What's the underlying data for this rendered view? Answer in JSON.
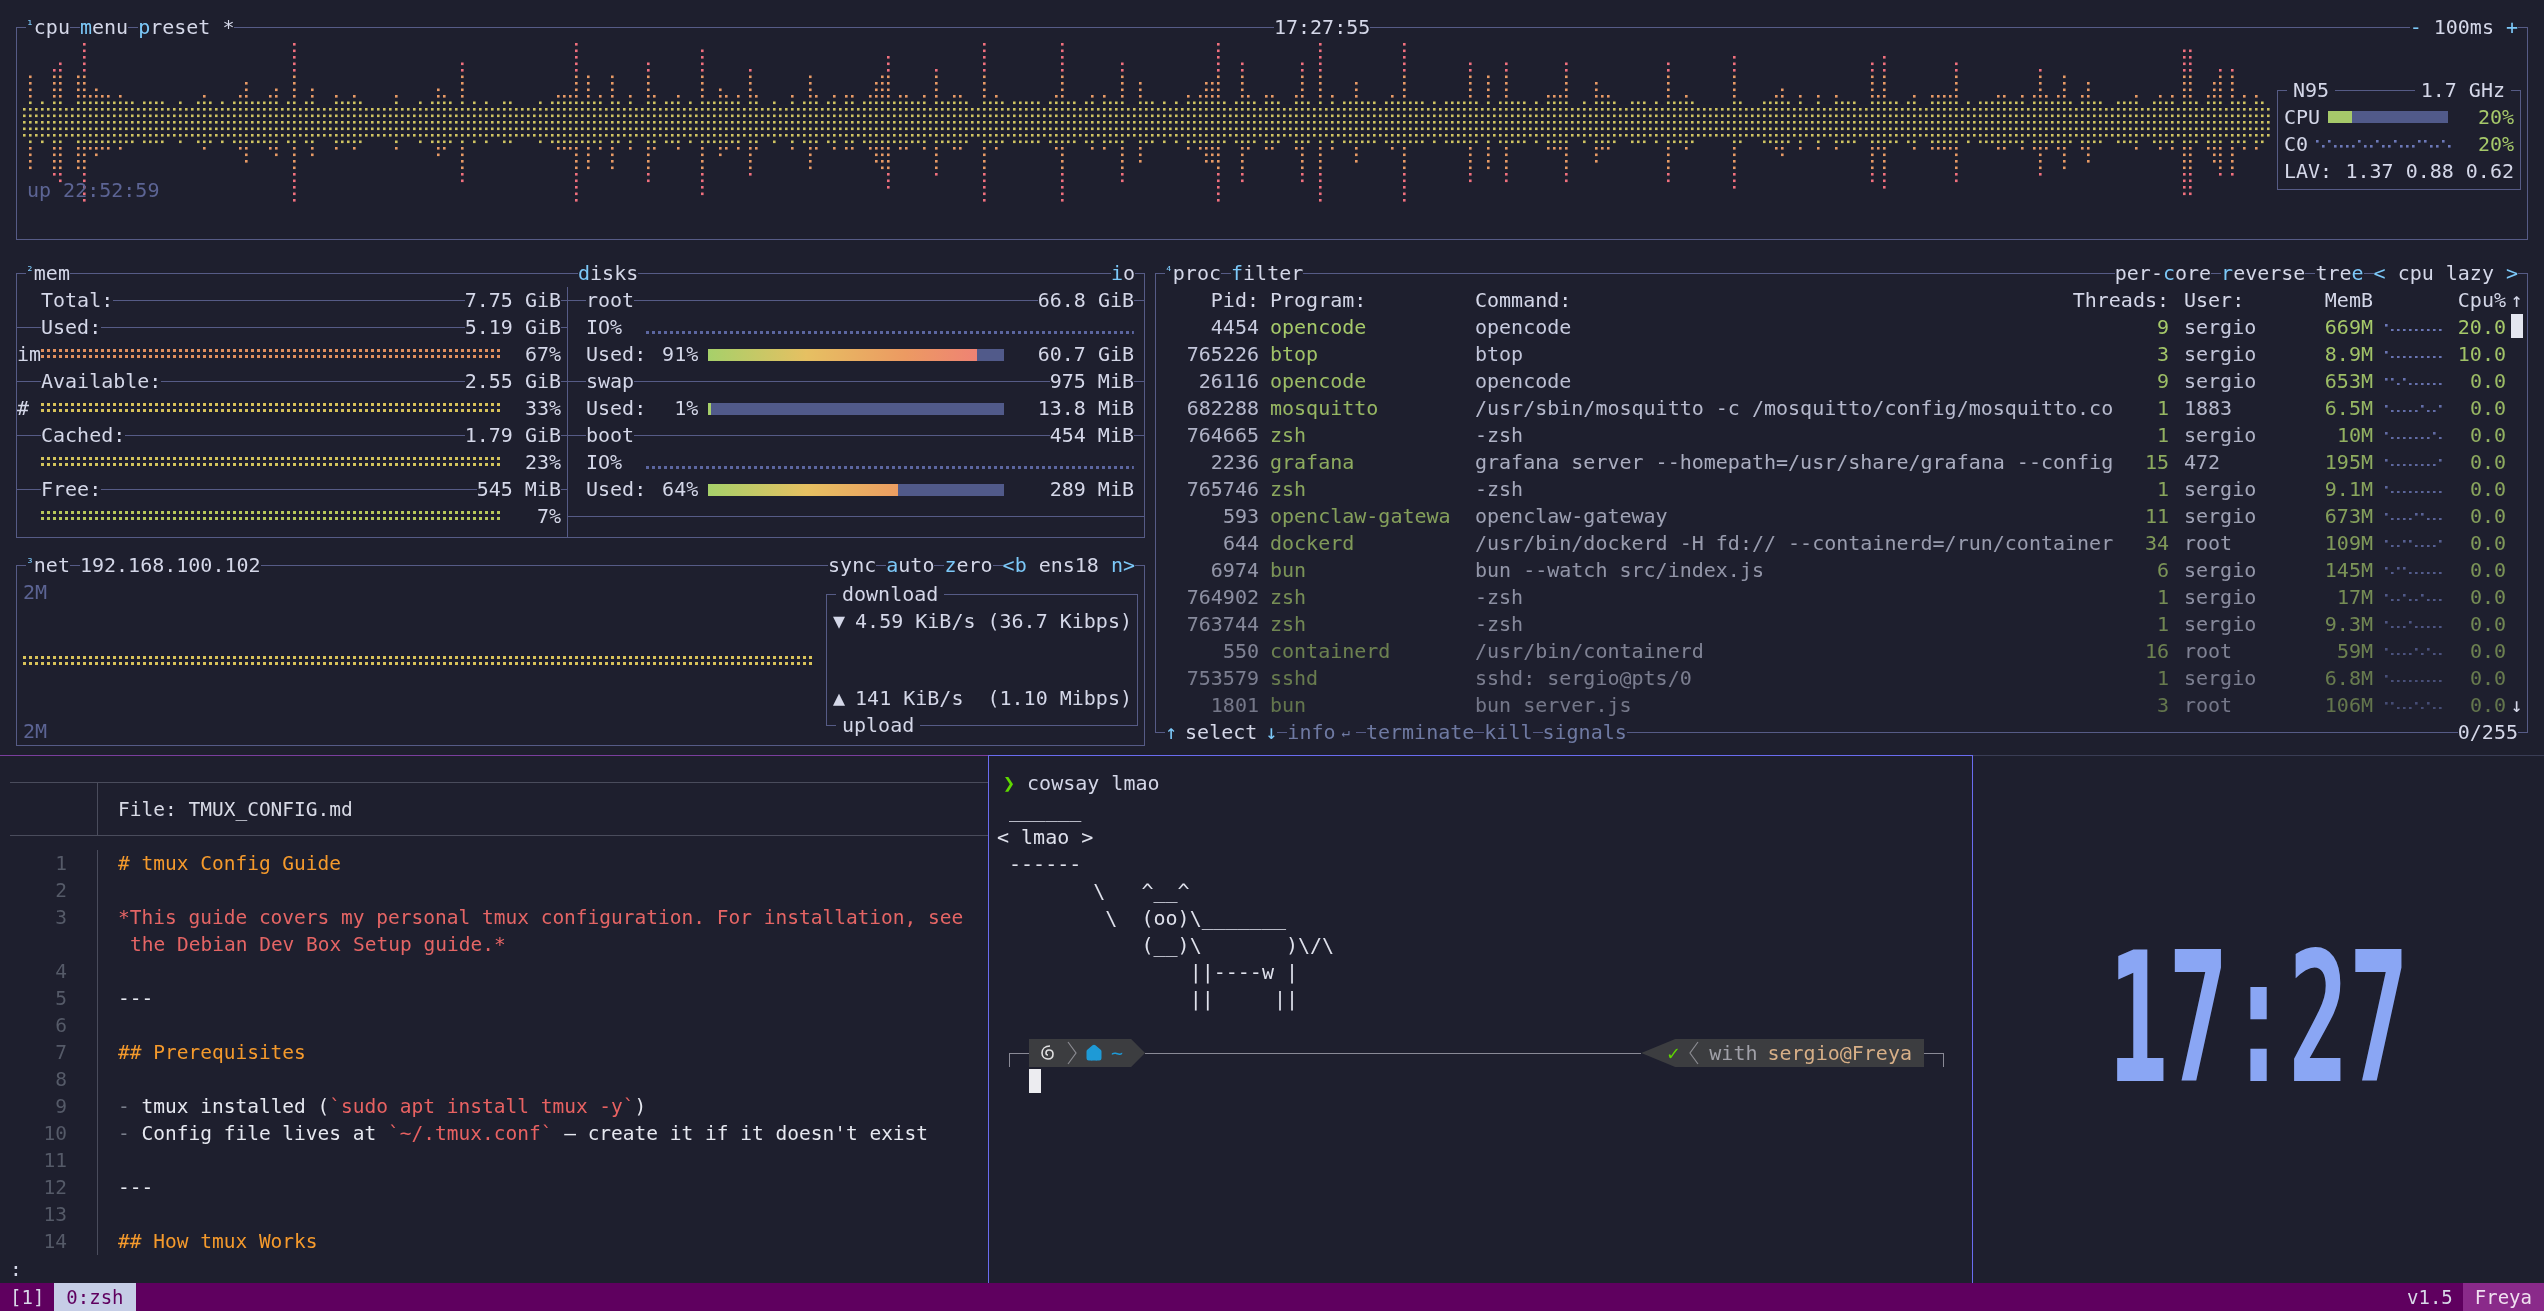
{
  "cpu": {
    "number": "¹",
    "title": "cpu",
    "menu": {
      "key": "m",
      "rest": "enu"
    },
    "preset": {
      "key": "p",
      "rest": "reset *"
    },
    "clock": "17:27:55",
    "interval_down": "-",
    "interval": "100ms",
    "interval_up": "+",
    "uptime": "up 22:52:59",
    "info": {
      "model": "N95",
      "frequency": "1.7 GHz",
      "cpu_label": "CPU",
      "level": 0.2,
      "cpu_percent": "20%",
      "core_label": "C0",
      "core_percent": "20%",
      "load_label": "LAV:",
      "load": "1.37 0.88 0.62"
    }
  },
  "mem": {
    "number": "²",
    "title": "mem",
    "rows": [
      {
        "label": "Total:",
        "value": "7.75 GiB"
      },
      {
        "label": "Used:",
        "value": "5.19 GiB",
        "graph_prefix": "im",
        "percent": "67%",
        "color": "#e0905e"
      },
      {
        "label": "Available:",
        "value": "2.55 GiB",
        "graph_prefix": "#",
        "percent": "33%",
        "color": "#d8c25a"
      },
      {
        "label": "Cached:",
        "value": "1.79 GiB",
        "percent": "23%",
        "color": "#d2c45c"
      },
      {
        "label": "Free:",
        "value": "545 MiB",
        "percent": "7%",
        "color": "#b8c85a"
      }
    ]
  },
  "disks": {
    "title": {
      "key": "d",
      "rest": "isks"
    },
    "io": {
      "key": "i",
      "rest": "o"
    },
    "items": [
      {
        "name": "root",
        "size": "66.8 GiB",
        "io_label": "IO%",
        "used_label": "Used:",
        "percent": "91%",
        "level": 0.91,
        "used": "60.7 GiB"
      },
      {
        "name": "swap",
        "size": "975 MiB",
        "used_label": "Used:",
        "percent": "1%",
        "level": 0.01,
        "used": "13.8 MiB"
      },
      {
        "name": "boot",
        "size": "454 MiB",
        "io_label": "IO%",
        "used_label": "Used:",
        "percent": "64%",
        "level": 0.64,
        "used": "289 MiB"
      }
    ]
  },
  "net": {
    "number": "³",
    "title": "net",
    "address": "192.168.100.102",
    "options": [
      {
        "rest": "sync"
      },
      {
        "key": "a",
        "rest": "uto"
      },
      {
        "key": "z",
        "rest": "ero"
      }
    ],
    "interface_prev": {
      "key": "<b"
    },
    "interface": "ens18",
    "interface_next": {
      "key": "n>"
    },
    "scale_top": "2M",
    "scale_bottom": "2M",
    "download_label": "download",
    "download_arrow": "▼",
    "download": "4.59 KiB/s (36.7 Kibps)",
    "upload_arrow": "▲",
    "upload": "141 KiB/s  (1.10 Mibps)",
    "upload_label": "upload"
  },
  "proc": {
    "number": "⁴",
    "title": "proc",
    "filter": {
      "key": "f",
      "rest": "ilter"
    },
    "options": [
      {
        "pre": "per-",
        "key": "c",
        "rest": "ore"
      },
      {
        "key": "r",
        "rest": "everse"
      },
      {
        "pre": "tre",
        "key": "e"
      }
    ],
    "sort_prev": {
      "key": "<"
    },
    "sort": "cpu lazy",
    "sort_next": {
      "key": ">"
    },
    "columns": [
      "Pid:",
      "Program:",
      "Command:",
      "Threads:",
      "User:",
      "MemB",
      "Cpu%"
    ],
    "scroll_up": "↑",
    "scroll_down": "↓",
    "rows": [
      {
        "pid": "4454",
        "program": "opencode",
        "command": "opencode",
        "threads": "9",
        "user": "sergio",
        "mem": "669M",
        "cpu": "20.0"
      },
      {
        "pid": "765226",
        "program": "btop",
        "command": "btop",
        "threads": "3",
        "user": "sergio",
        "mem": "8.9M",
        "cpu": "10.0"
      },
      {
        "pid": "26116",
        "program": "opencode",
        "command": "opencode",
        "threads": "9",
        "user": "sergio",
        "mem": "653M",
        "cpu": "0.0"
      },
      {
        "pid": "682288",
        "program": "mosquitto",
        "command": "/usr/sbin/mosquitto -c /mosquitto/config/mosquitto.co",
        "threads": "1",
        "user": "1883",
        "mem": "6.5M",
        "cpu": "0.0"
      },
      {
        "pid": "764665",
        "program": "zsh",
        "command": "-zsh",
        "threads": "1",
        "user": "sergio",
        "mem": "10M",
        "cpu": "0.0"
      },
      {
        "pid": "2236",
        "program": "grafana",
        "command": "grafana server --homepath=/usr/share/grafana --config",
        "threads": "15",
        "user": "472",
        "mem": "195M",
        "cpu": "0.0"
      },
      {
        "pid": "765746",
        "program": "zsh",
        "command": "-zsh",
        "threads": "1",
        "user": "sergio",
        "mem": "9.1M",
        "cpu": "0.0"
      },
      {
        "pid": "593",
        "program": "openclaw-gatewa",
        "command": "openclaw-gateway",
        "threads": "11",
        "user": "sergio",
        "mem": "673M",
        "cpu": "0.0"
      },
      {
        "pid": "644",
        "program": "dockerd",
        "command": "/usr/bin/dockerd -H fd:// --containerd=/run/container",
        "threads": "34",
        "user": "root",
        "mem": "109M",
        "cpu": "0.0"
      },
      {
        "pid": "6974",
        "program": "bun",
        "command": "bun --watch src/index.js",
        "threads": "6",
        "user": "sergio",
        "mem": "145M",
        "cpu": "0.0"
      },
      {
        "pid": "764902",
        "program": "zsh",
        "command": "-zsh",
        "threads": "1",
        "user": "sergio",
        "mem": "17M",
        "cpu": "0.0"
      },
      {
        "pid": "763744",
        "program": "zsh",
        "command": "-zsh",
        "threads": "1",
        "user": "sergio",
        "mem": "9.3M",
        "cpu": "0.0"
      },
      {
        "pid": "550",
        "program": "containerd",
        "command": "/usr/bin/containerd",
        "threads": "16",
        "user": "root",
        "mem": "59M",
        "cpu": "0.0"
      },
      {
        "pid": "753579",
        "program": "sshd",
        "command": "sshd: sergio@pts/0",
        "threads": "1",
        "user": "sergio",
        "mem": "6.8M",
        "cpu": "0.0"
      },
      {
        "pid": "1801",
        "program": "bun",
        "command": "bun server.js",
        "threads": "3",
        "user": "root",
        "mem": "106M",
        "cpu": "0.0"
      }
    ],
    "footer": {
      "up": "↑",
      "select": "select",
      "down": "↓",
      "actions": [
        {
          "label": "info",
          "suffix": "↵"
        },
        {
          "label": "terminate"
        },
        {
          "label": "kill"
        },
        {
          "label": "signals"
        }
      ],
      "count": "0/255"
    }
  },
  "editor": {
    "file": "File: TMUX_CONFIG.md",
    "lines": [
      {
        "number": "1",
        "segments": [
          {
            "kind": "heading",
            "text": "# tmux Config Guide"
          }
        ]
      },
      {
        "number": "2"
      },
      {
        "number": "3",
        "segments": [
          {
            "kind": "emphasis",
            "text": "*This guide covers my personal tmux configuration. For installation, see"
          }
        ],
        "wrapped": "the Debian Dev Box Setup guide.*"
      },
      {
        "number": "4"
      },
      {
        "number": "5",
        "segments": [
          {
            "kind": "plain",
            "text": "---"
          }
        ]
      },
      {
        "number": "6"
      },
      {
        "number": "7",
        "segments": [
          {
            "kind": "heading",
            "text": "## Prerequisites"
          }
        ]
      },
      {
        "number": "8"
      },
      {
        "number": "9",
        "segments": [
          {
            "kind": "marker",
            "text": "-"
          },
          {
            "kind": "plain",
            "text": " tmux installed ("
          },
          {
            "kind": "code",
            "text": "`sudo apt install tmux -y`"
          },
          {
            "kind": "plain",
            "text": ")"
          }
        ]
      },
      {
        "number": "10",
        "segments": [
          {
            "kind": "marker",
            "text": "-"
          },
          {
            "kind": "plain",
            "text": " Config file lives at "
          },
          {
            "kind": "code",
            "text": "`~/.tmux.conf`"
          },
          {
            "kind": "plain",
            "text": " — create it if it doesn't exist"
          }
        ]
      },
      {
        "number": "11"
      },
      {
        "number": "12",
        "segments": [
          {
            "kind": "plain",
            "text": "---"
          }
        ]
      },
      {
        "number": "13"
      },
      {
        "number": "14",
        "segments": [
          {
            "kind": "heading",
            "text": "## How tmux Works"
          }
        ]
      }
    ],
    "pager_prompt": ":"
  },
  "shell": {
    "prompt_symbol": "❯",
    "command": "cowsay lmao",
    "output": [
      " ______",
      "< lmao >",
      " ------",
      "        \\   ^__^",
      "         \\  (oo)\\_______",
      "            (__)\\       )\\/\\",
      "                ||----w |",
      "                ||     ||"
    ],
    "directory": "~",
    "status_symbol": "✓",
    "with": "with",
    "user_host": "sergio@Freya"
  },
  "clock": "17:27",
  "status": {
    "session": "[1]",
    "windows": [
      {
        "label": "0:zsh",
        "selected": true
      }
    ],
    "version": "v1.5",
    "host": "Freya"
  }
}
